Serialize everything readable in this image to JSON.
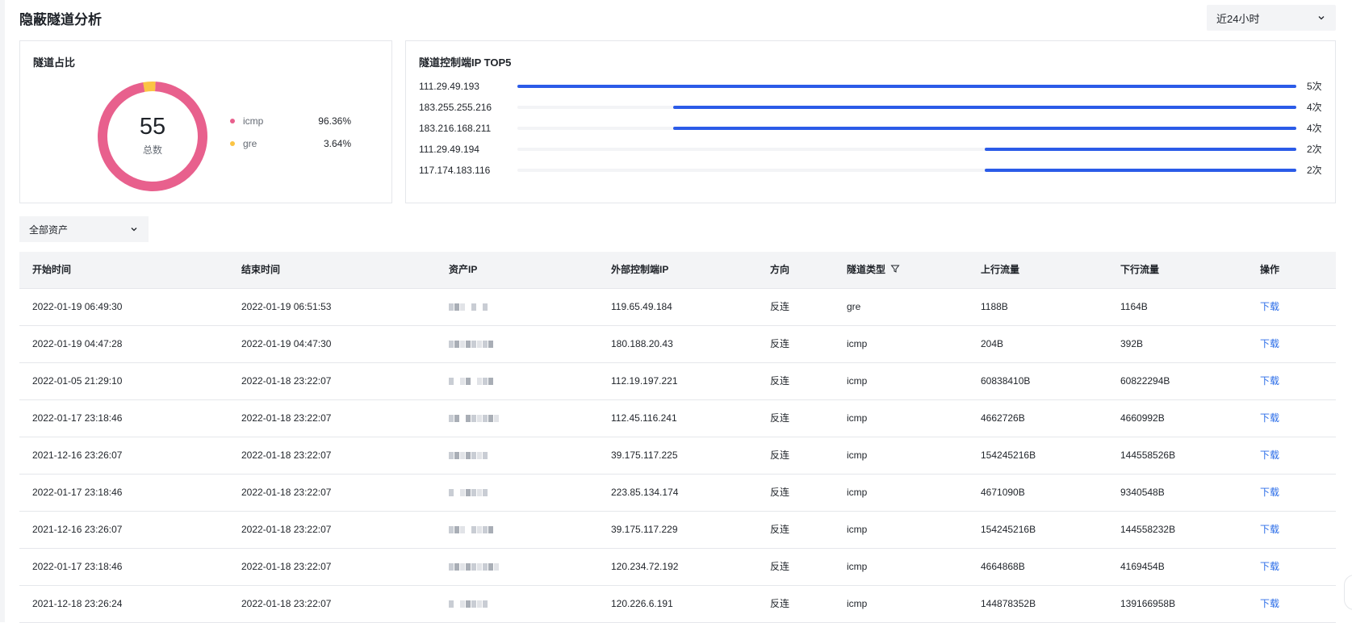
{
  "page": {
    "title": "隐蔽隧道分析",
    "time_range": "近24小时",
    "asset_filter": "全部资产"
  },
  "donut": {
    "title": "隧道占比",
    "total": "55",
    "total_label": "总数",
    "legend": [
      {
        "name": "icmp",
        "pct": "96.36%",
        "color": "#e8608d",
        "value": 96.36
      },
      {
        "name": "gre",
        "pct": "3.64%",
        "color": "#fbc444",
        "value": 3.64
      }
    ]
  },
  "top5": {
    "title": "隧道控制端IP TOP5",
    "max": 5,
    "color": "#2b5be8",
    "items": [
      {
        "ip": "111.29.49.193",
        "count": "5次",
        "value": 5
      },
      {
        "ip": "183.255.255.216",
        "count": "4次",
        "value": 4
      },
      {
        "ip": "183.216.168.211",
        "count": "4次",
        "value": 4
      },
      {
        "ip": "111.29.49.194",
        "count": "2次",
        "value": 2
      },
      {
        "ip": "117.174.183.116",
        "count": "2次",
        "value": 2
      }
    ]
  },
  "table": {
    "headers": {
      "start": "开始时间",
      "end": "结束时间",
      "asset_ip": "资产IP",
      "ext_ip": "外部控制端IP",
      "direction": "方向",
      "type": "隧道类型",
      "up": "上行流量",
      "down": "下行流量",
      "action": "操作"
    },
    "rows": [
      {
        "start": "2022-01-19 06:49:30",
        "end": "2022-01-19 06:51:53",
        "ext_ip": "119.65.49.184",
        "direction": "反连",
        "type": "gre",
        "up": "1188B",
        "down": "1164B",
        "action": "下载"
      },
      {
        "start": "2022-01-19 04:47:28",
        "end": "2022-01-19 04:47:30",
        "ext_ip": "180.188.20.43",
        "direction": "反连",
        "type": "icmp",
        "up": "204B",
        "down": "392B",
        "action": "下载"
      },
      {
        "start": "2022-01-05 21:29:10",
        "end": "2022-01-18 23:22:07",
        "ext_ip": "112.19.197.221",
        "direction": "反连",
        "type": "icmp",
        "up": "60838410B",
        "down": "60822294B",
        "action": "下载"
      },
      {
        "start": "2022-01-17 23:18:46",
        "end": "2022-01-18 23:22:07",
        "ext_ip": "112.45.116.241",
        "direction": "反连",
        "type": "icmp",
        "up": "4662726B",
        "down": "4660992B",
        "action": "下载"
      },
      {
        "start": "2021-12-16 23:26:07",
        "end": "2022-01-18 23:22:07",
        "ext_ip": "39.175.117.225",
        "direction": "反连",
        "type": "icmp",
        "up": "154245216B",
        "down": "144558526B",
        "action": "下载"
      },
      {
        "start": "2022-01-17 23:18:46",
        "end": "2022-01-18 23:22:07",
        "ext_ip": "223.85.134.174",
        "direction": "反连",
        "type": "icmp",
        "up": "4671090B",
        "down": "9340548B",
        "action": "下载"
      },
      {
        "start": "2021-12-16 23:26:07",
        "end": "2022-01-18 23:22:07",
        "ext_ip": "39.175.117.229",
        "direction": "反连",
        "type": "icmp",
        "up": "154245216B",
        "down": "144558232B",
        "action": "下载"
      },
      {
        "start": "2022-01-17 23:18:46",
        "end": "2022-01-18 23:22:07",
        "ext_ip": "120.234.72.192",
        "direction": "反连",
        "type": "icmp",
        "up": "4664868B",
        "down": "4169454B",
        "action": "下载"
      },
      {
        "start": "2021-12-18 23:26:24",
        "end": "2022-01-18 23:22:07",
        "ext_ip": "120.226.6.191",
        "direction": "反连",
        "type": "icmp",
        "up": "144878352B",
        "down": "139166958B",
        "action": "下载"
      }
    ]
  }
}
